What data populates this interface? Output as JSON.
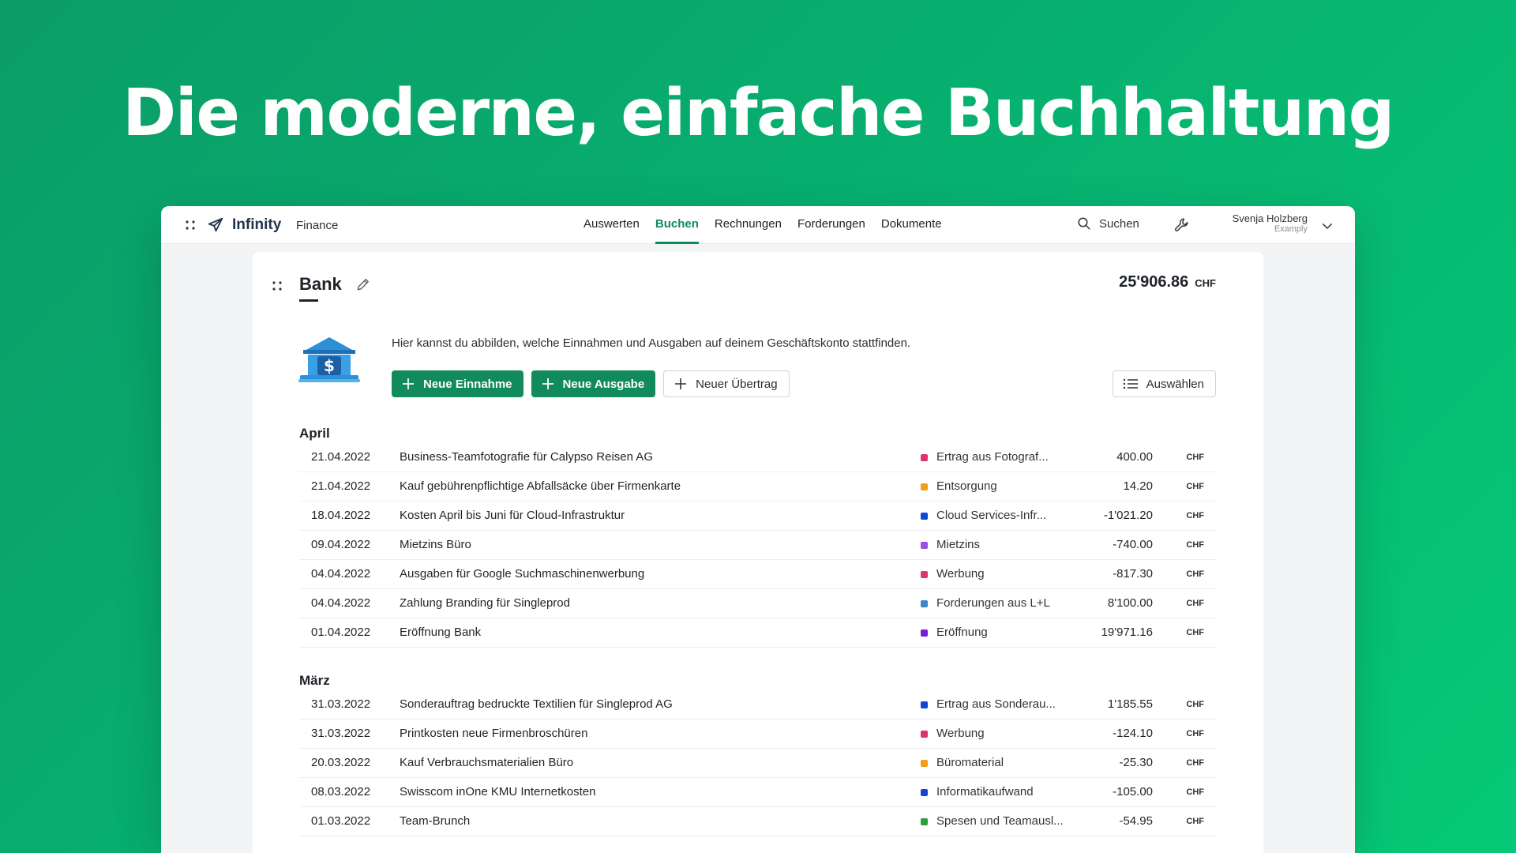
{
  "hero": {
    "title": "Die moderne, einfache Buchhaltung"
  },
  "topbar": {
    "brand": "Infinity",
    "module": "Finance",
    "nav": [
      "Auswerten",
      "Buchen",
      "Rechnungen",
      "Forderungen",
      "Dokumente"
    ],
    "active_nav": "Buchen",
    "search_label": "Suchen",
    "user_name": "Svenja Holzberg",
    "user_org": "Examply"
  },
  "panel": {
    "title": "Bank",
    "balance": "25'906.86",
    "currency": "CHF",
    "description": "Hier kannst du abbilden, welche Einnahmen und Ausgaben auf deinem Geschäftskonto stattfinden.",
    "buttons": {
      "income": "Neue Einnahme",
      "expense": "Neue Ausgabe",
      "transfer": "Neuer Übertrag",
      "select": "Auswählen"
    }
  },
  "colors": {
    "brand_green": "#118a5c",
    "cat_red": "#e0336b",
    "cat_orange": "#f59e1b",
    "cat_blue": "#1446d6",
    "cat_purple": "#9a4fe0",
    "cat_steel": "#3f86c9",
    "cat_violet": "#7a1fd8",
    "cat_green": "#2f9e3c"
  },
  "sections": [
    {
      "name": "April",
      "rows": [
        {
          "date": "21.04.2022",
          "desc": "Business-Teamfotografie für Calypso Reisen AG",
          "cat": "Ertrag aus Fotograf...",
          "color": "#e0336b",
          "amount": "400.00",
          "cur": "CHF"
        },
        {
          "date": "21.04.2022",
          "desc": "Kauf gebührenpflichtige Abfallsäcke über Firmenkarte",
          "cat": "Entsorgung",
          "color": "#f59e1b",
          "amount": "14.20",
          "cur": "CHF"
        },
        {
          "date": "18.04.2022",
          "desc": "Kosten April bis Juni für Cloud-Infrastruktur",
          "cat": "Cloud Services-Infr...",
          "color": "#1446d6",
          "amount": "-1'021.20",
          "cur": "CHF"
        },
        {
          "date": "09.04.2022",
          "desc": "Mietzins Büro",
          "cat": "Mietzins",
          "color": "#9a4fe0",
          "amount": "-740.00",
          "cur": "CHF"
        },
        {
          "date": "04.04.2022",
          "desc": "Ausgaben für Google Suchmaschinenwerbung",
          "cat": "Werbung",
          "color": "#e0336b",
          "amount": "-817.30",
          "cur": "CHF"
        },
        {
          "date": "04.04.2022",
          "desc": "Zahlung Branding für Singleprod",
          "cat": "Forderungen aus L+L",
          "color": "#3f86c9",
          "amount": "8'100.00",
          "cur": "CHF"
        },
        {
          "date": "01.04.2022",
          "desc": "Eröffnung Bank",
          "cat": "Eröffnung",
          "color": "#7a1fd8",
          "amount": "19'971.16",
          "cur": "CHF"
        }
      ]
    },
    {
      "name": "März",
      "rows": [
        {
          "date": "31.03.2022",
          "desc": "Sonderauftrag bedruckte Textilien für Singleprod AG",
          "cat": "Ertrag aus Sonderau...",
          "color": "#1446d6",
          "amount": "1'185.55",
          "cur": "CHF"
        },
        {
          "date": "31.03.2022",
          "desc": "Printkosten neue Firmenbroschüren",
          "cat": "Werbung",
          "color": "#e0336b",
          "amount": "-124.10",
          "cur": "CHF"
        },
        {
          "date": "20.03.2022",
          "desc": "Kauf Verbrauchsmaterialien Büro",
          "cat": "Büromaterial",
          "color": "#f59e1b",
          "amount": "-25.30",
          "cur": "CHF"
        },
        {
          "date": "08.03.2022",
          "desc": "Swisscom inOne KMU Internetkosten",
          "cat": "Informatikaufwand",
          "color": "#1446d6",
          "amount": "-105.00",
          "cur": "CHF"
        },
        {
          "date": "01.03.2022",
          "desc": "Team-Brunch",
          "cat": "Spesen und Teamausl...",
          "color": "#2f9e3c",
          "amount": "-54.95",
          "cur": "CHF"
        }
      ]
    }
  ]
}
